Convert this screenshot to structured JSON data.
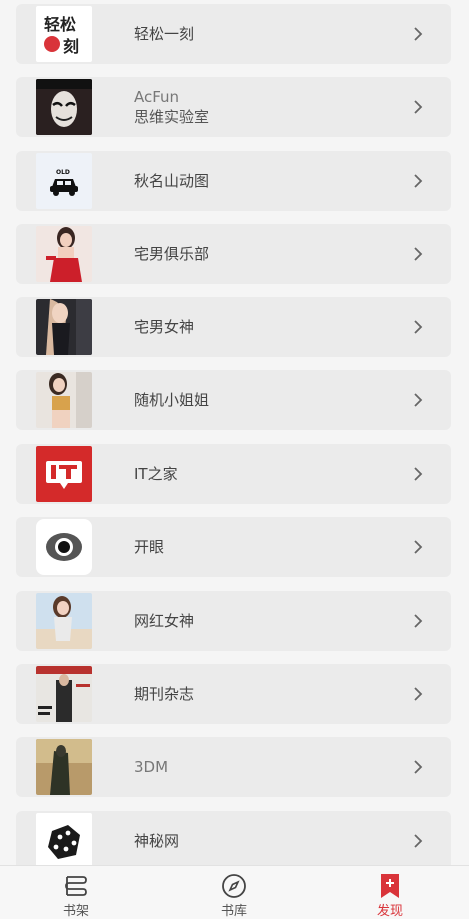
{
  "items": [
    {
      "title": "轻松一刻",
      "icon": "brand-logo-icon"
    },
    {
      "title": "AcFun",
      "subtitle": "思维实验室",
      "icon": "mask-avatar-icon"
    },
    {
      "title": "秋名山动图",
      "icon": "old-car-icon"
    },
    {
      "title": "宅男俱乐部",
      "icon": "photo-thumbnail-icon"
    },
    {
      "title": "宅男女神",
      "icon": "photo-thumbnail-icon"
    },
    {
      "title": "随机小姐姐",
      "icon": "photo-thumbnail-icon"
    },
    {
      "title": "IT之家",
      "icon": "it-logo-icon"
    },
    {
      "title": "开眼",
      "icon": "eye-icon"
    },
    {
      "title": "网红女神",
      "icon": "photo-thumbnail-icon"
    },
    {
      "title": "期刊杂志",
      "icon": "magazine-cover-icon"
    },
    {
      "title": "3DM",
      "icon": "game-art-icon"
    },
    {
      "title": "神秘网",
      "icon": "dice-icon"
    }
  ],
  "tabs": [
    {
      "label": "书架",
      "icon": "bookshelf-icon"
    },
    {
      "label": "书库",
      "icon": "compass-icon"
    },
    {
      "label": "发现",
      "icon": "bookmark-add-icon",
      "active": true
    }
  ],
  "colors": {
    "accent": "#d9343a",
    "card": "#ebebeb",
    "background": "#f5f5f5"
  }
}
